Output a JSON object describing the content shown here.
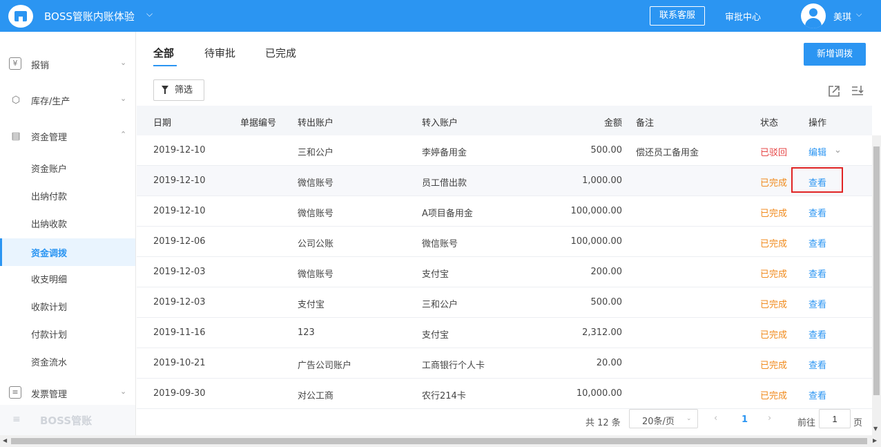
{
  "header": {
    "app_title": "BOSS管账内账体验",
    "contact_label": "联系客服",
    "approval_label": "审批中心",
    "user_name": "美琪"
  },
  "sidebar": {
    "groups": [
      {
        "label": "报销"
      },
      {
        "label": "库存/生产"
      },
      {
        "label": "资金管理"
      },
      {
        "label": "发票管理"
      }
    ],
    "sub_items": [
      {
        "label": "资金账户"
      },
      {
        "label": "出纳付款"
      },
      {
        "label": "出纳收款"
      },
      {
        "label": "资金调拨",
        "active": true
      },
      {
        "label": "收支明细"
      },
      {
        "label": "收款计划"
      },
      {
        "label": "付款计划"
      },
      {
        "label": "资金流水"
      }
    ],
    "footer_brand": "BOSS管账"
  },
  "tabs": [
    {
      "label": "全部",
      "active": true
    },
    {
      "label": "待审批"
    },
    {
      "label": "已完成"
    }
  ],
  "toolbar": {
    "new_button": "新增调拨",
    "filter_button": "筛选"
  },
  "table": {
    "headers": {
      "date": "日期",
      "doc_no": "单据编号",
      "out_account": "转出账户",
      "in_account": "转入账户",
      "amount": "金额",
      "note": "备注",
      "status": "状态",
      "action": "操作"
    },
    "rows": [
      {
        "date": "2019-12-10",
        "out": "三和公户",
        "in": "李婷备用金",
        "amount": "500.00",
        "note": "偿还员工备用金",
        "status": "已驳回",
        "action": "编辑"
      },
      {
        "date": "2019-12-10",
        "out": "微信账号",
        "in": "员工借出款",
        "amount": "1,000.00",
        "note": "",
        "status": "已完成",
        "action": "查看"
      },
      {
        "date": "2019-12-10",
        "out": "微信账号",
        "in": "A项目备用金",
        "amount": "100,000.00",
        "note": "",
        "status": "已完成",
        "action": "查看"
      },
      {
        "date": "2019-12-06",
        "out": "公司公账",
        "in": "微信账号",
        "amount": "100,000.00",
        "note": "",
        "status": "已完成",
        "action": "查看"
      },
      {
        "date": "2019-12-03",
        "out": "微信账号",
        "in": "支付宝",
        "amount": "200.00",
        "note": "",
        "status": "已完成",
        "action": "查看"
      },
      {
        "date": "2019-12-03",
        "out": "支付宝",
        "in": "三和公户",
        "amount": "500.00",
        "note": "",
        "status": "已完成",
        "action": "查看"
      },
      {
        "date": "2019-11-16",
        "out": "123",
        "in": "支付宝",
        "amount": "2,312.00",
        "note": "",
        "status": "已完成",
        "action": "查看"
      },
      {
        "date": "2019-10-21",
        "out": "广告公司账户",
        "in": "工商银行个人卡",
        "amount": "20.00",
        "note": "",
        "status": "已完成",
        "action": "查看"
      },
      {
        "date": "2019-09-30",
        "out": "对公工商",
        "in": "农行214卡",
        "amount": "10,000.00",
        "note": "",
        "status": "已完成",
        "action": "查看"
      }
    ]
  },
  "pagination": {
    "total_text": "共 12 条",
    "page_size": "20条/页",
    "current_page": "1",
    "goto_label": "前往",
    "goto_value": "1",
    "page_suffix": "页"
  },
  "colors": {
    "brand": "#2b95f2",
    "rejected": "#e64545",
    "completed": "#f08a1c",
    "highlight": "#e02424"
  }
}
